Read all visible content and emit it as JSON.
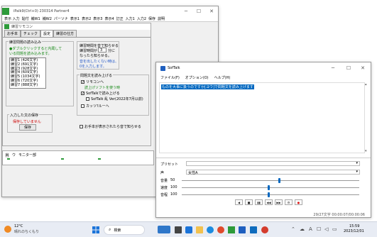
{
  "accent_colors": {
    "green": "#2e9b3a",
    "blue": "#0067c0",
    "taskbar": "#e8ecf4"
  },
  "main_window": {
    "title": "iPalk9(Ctrl+0) 230314  Partner4",
    "menu": [
      "表示 入力",
      "貼付",
      "補W1",
      "補W2",
      "パーソナ",
      "表示1",
      "表示2",
      "表示3",
      "表示4",
      "訂正",
      "入力1",
      "入力2",
      "保存",
      "説明"
    ],
    "sub_title": "練習リモコン",
    "tabs": [
      "お手本",
      "チェック",
      "設定",
      "練習の仕方"
    ],
    "left_group": {
      "title": "練習問題の読み込み",
      "hint_lines": [
        "●ダブルクリックすると内蔵して",
        "いる問題を読み込みます。"
      ],
      "list_items": [
        "練習1 (426文字)",
        "練習2 (691文字)",
        "練習3 (928文字)",
        "練習4 (609文字)",
        "練習5 (1034文字)",
        "練習6 (720文字)",
        "練習7 (888文字)"
      ]
    },
    "save_group": {
      "title": "入力した文の保存",
      "status": "保存していません",
      "save_button": "保存"
    },
    "timer_group": {
      "lines": [
        "練習時間を音で知らせる",
        "練習時間が",
        "分に",
        "なったら知らせる。",
        "音を出したくない時は、",
        "0を入力します。"
      ],
      "value": "3"
    },
    "read_group": {
      "title": "問題文を読み上げる",
      "option1": "リモコンへ",
      "option1_note": "読上げソフトを使う時",
      "option2": "SofTalkで読み上げる",
      "option3": "SofTalk 乱 Ver(2022年7月以前)",
      "option4": "カッツ?ルーへ"
    },
    "bottom_option": "お手本が表示されたら音で知らせる",
    "monitor_label": "モニター部",
    "monitor_tab": "ウ"
  },
  "softalk": {
    "title": "SofTalk",
    "menu": [
      "ファイル(F)",
      "オプション(O)",
      "ヘルプ(H)"
    ],
    "text": "ものを大事に扱うのですか[ヨウ]で問題文を読み上げます",
    "preset_label": "プリセット",
    "voice_label": "声",
    "voice_value": "女性A",
    "sliders": [
      {
        "label": "音量",
        "value": "50",
        "level": 0.55
      },
      {
        "label": "速度",
        "value": "100",
        "level": 0.49
      },
      {
        "label": "音程",
        "value": "100",
        "level": 0.49
      }
    ],
    "playback_buttons": [
      "◀",
      "■",
      "▮▮",
      "◀◀",
      "▶▶",
      "⚙",
      "●"
    ],
    "status": "29/27文字  00:00:07/00:00:06"
  },
  "taskbar": {
    "weather_temp": "12°C",
    "weather_desc": "晴れのちくもり",
    "search_label": "検索",
    "time": "15:59",
    "date": "2023/12/01"
  }
}
